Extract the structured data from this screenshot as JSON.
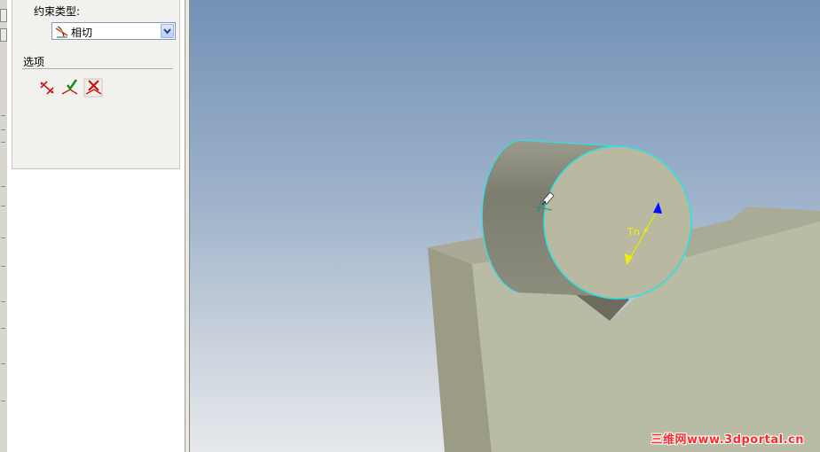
{
  "property_panel": {
    "constraint_type_label": "约束类型:",
    "constraint_type_value": "相切",
    "options_label": "选项"
  },
  "viewport": {
    "dimension_label": "Tn",
    "watermark": "三维网www.3dportal.cn"
  },
  "colors": {
    "cylinder_edge": "#2fe0e0",
    "model_face": "#b9bca5",
    "arrow_blue": "#0000ff",
    "arrow_yellow": "#ffff00"
  },
  "icons": [
    "tangent-icon",
    "flip-direction-icon",
    "confirm-check-icon",
    "cancel-x-icon"
  ]
}
